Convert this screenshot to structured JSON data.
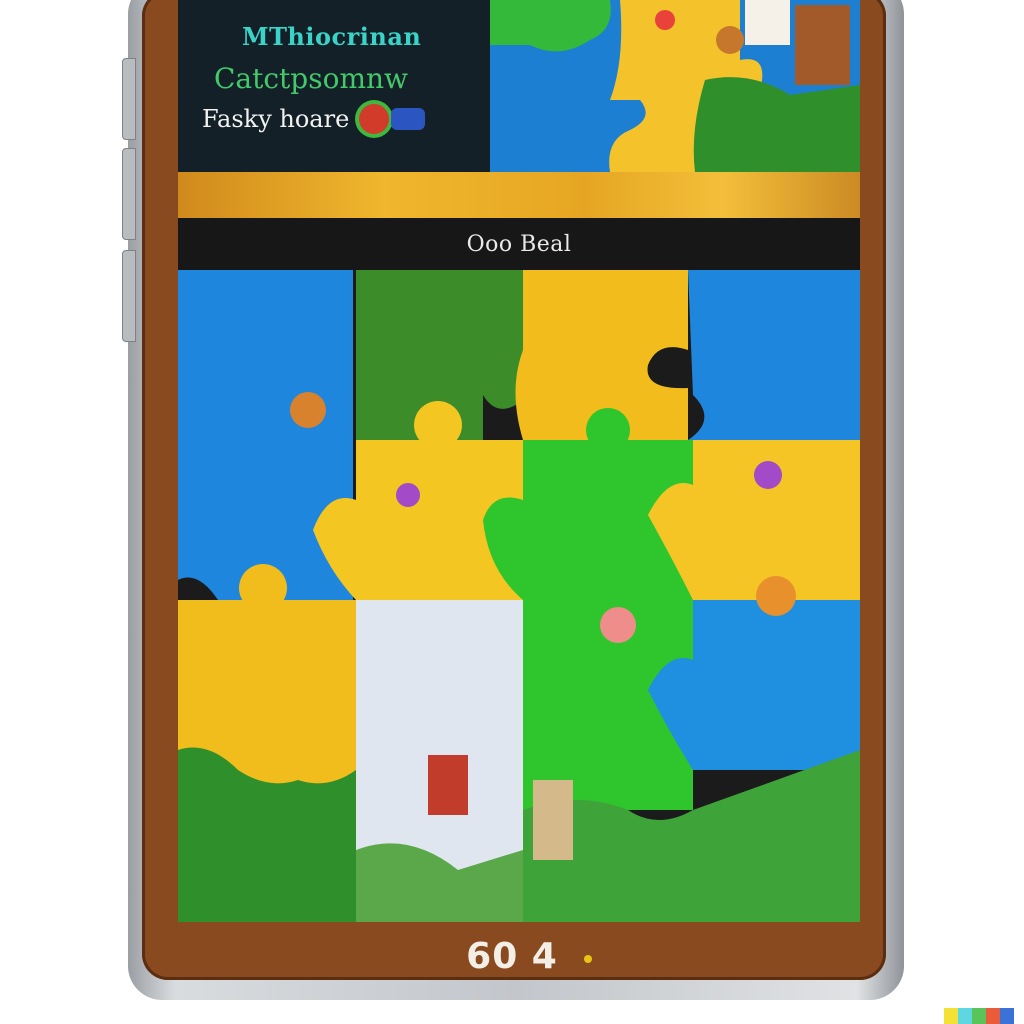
{
  "header": {
    "title": "MThiocrinan",
    "subtitle": "Catctpsomnw",
    "mode_label": "Fasky hoare"
  },
  "status": {
    "label": "Ooo Beal"
  },
  "counter": {
    "value": "60 4"
  },
  "colors": {
    "frame": "#8a4a1f",
    "puzzle_blue": "#1f8fe0",
    "puzzle_yellow": "#f4c320",
    "puzzle_green": "#2fc62c",
    "title_teal": "#3ad3c8",
    "subtitle_green": "#42c96a"
  },
  "icons": [
    "red-mode-icon",
    "blue-mode-icon"
  ]
}
